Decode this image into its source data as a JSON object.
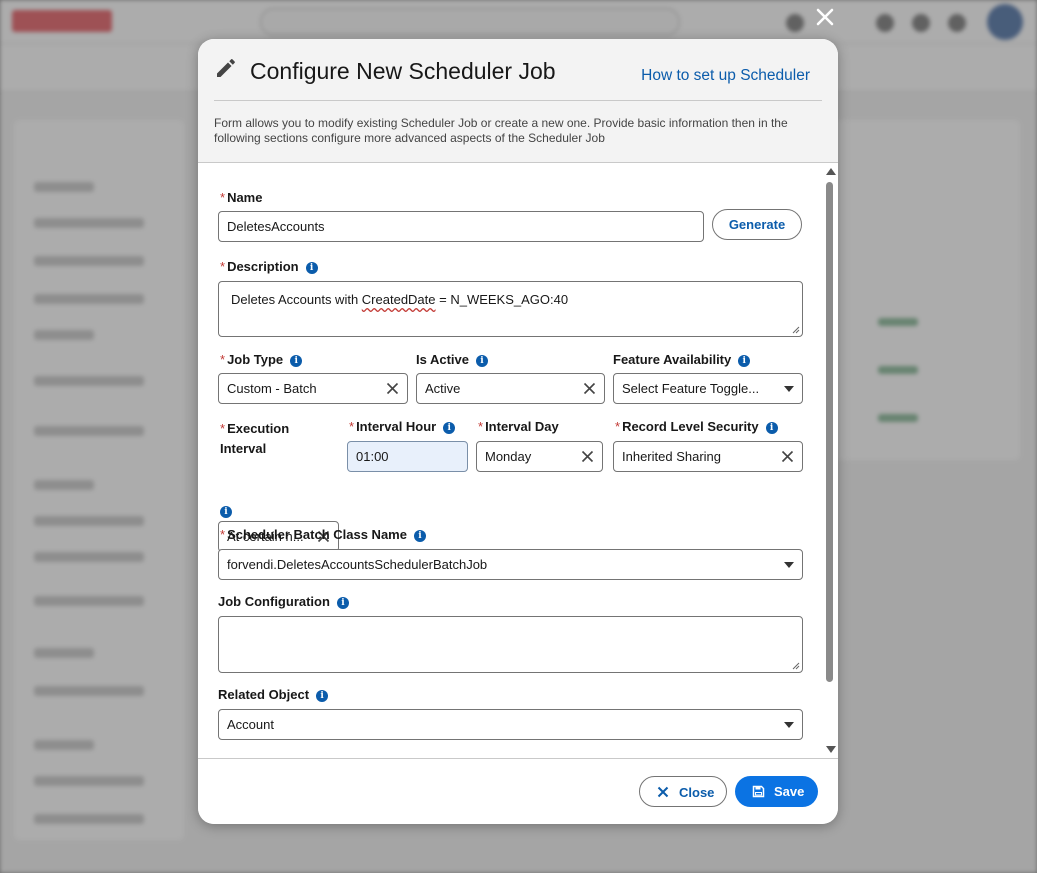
{
  "modal": {
    "title": "Configure New Scheduler Job",
    "help_link": "How to set up Scheduler",
    "description": "Form allows you to modify existing Scheduler Job or create a new one. Provide basic information then in the following sections configure more advanced aspects of the Scheduler Job"
  },
  "form": {
    "name": {
      "label": "Name",
      "value": "DeletesAccounts",
      "required": true
    },
    "generate_label": "Generate",
    "description": {
      "label": "Description",
      "value_prefix": "Deletes Accounts with ",
      "value_misspelled": "CreatedDate",
      "value_suffix": " = N_WEEKS_AGO:40",
      "required": true
    },
    "job_type": {
      "label": "Job Type",
      "value": "Custom - Batch",
      "required": true
    },
    "is_active": {
      "label": "Is Active",
      "value": "Active"
    },
    "feature_availability": {
      "label": "Feature Availability",
      "value": "Select Feature Toggle..."
    },
    "execution_interval": {
      "label_line1": "Execution",
      "label_line2": "Interval",
      "value": "At certain h...",
      "required": true
    },
    "interval_hour": {
      "label": "Interval Hour",
      "value": "01:00",
      "required": true
    },
    "interval_day": {
      "label": "Interval Day",
      "value": "Monday",
      "required": true
    },
    "record_level_security": {
      "label": "Record Level Security",
      "value": "Inherited Sharing",
      "required": true
    },
    "batch_class": {
      "label": "Scheduler Batch Class Name",
      "value": "forvendi.DeletesAccountsSchedulerBatchJob",
      "required": true
    },
    "job_configuration": {
      "label": "Job Configuration",
      "value": ""
    },
    "related_object": {
      "label": "Related Object",
      "value": "Account"
    }
  },
  "footer": {
    "close_label": "Close",
    "save_label": "Save"
  },
  "colors": {
    "brand_blue": "#0b5cab",
    "save_blue": "#0b73e3",
    "required_red": "#c23934"
  }
}
